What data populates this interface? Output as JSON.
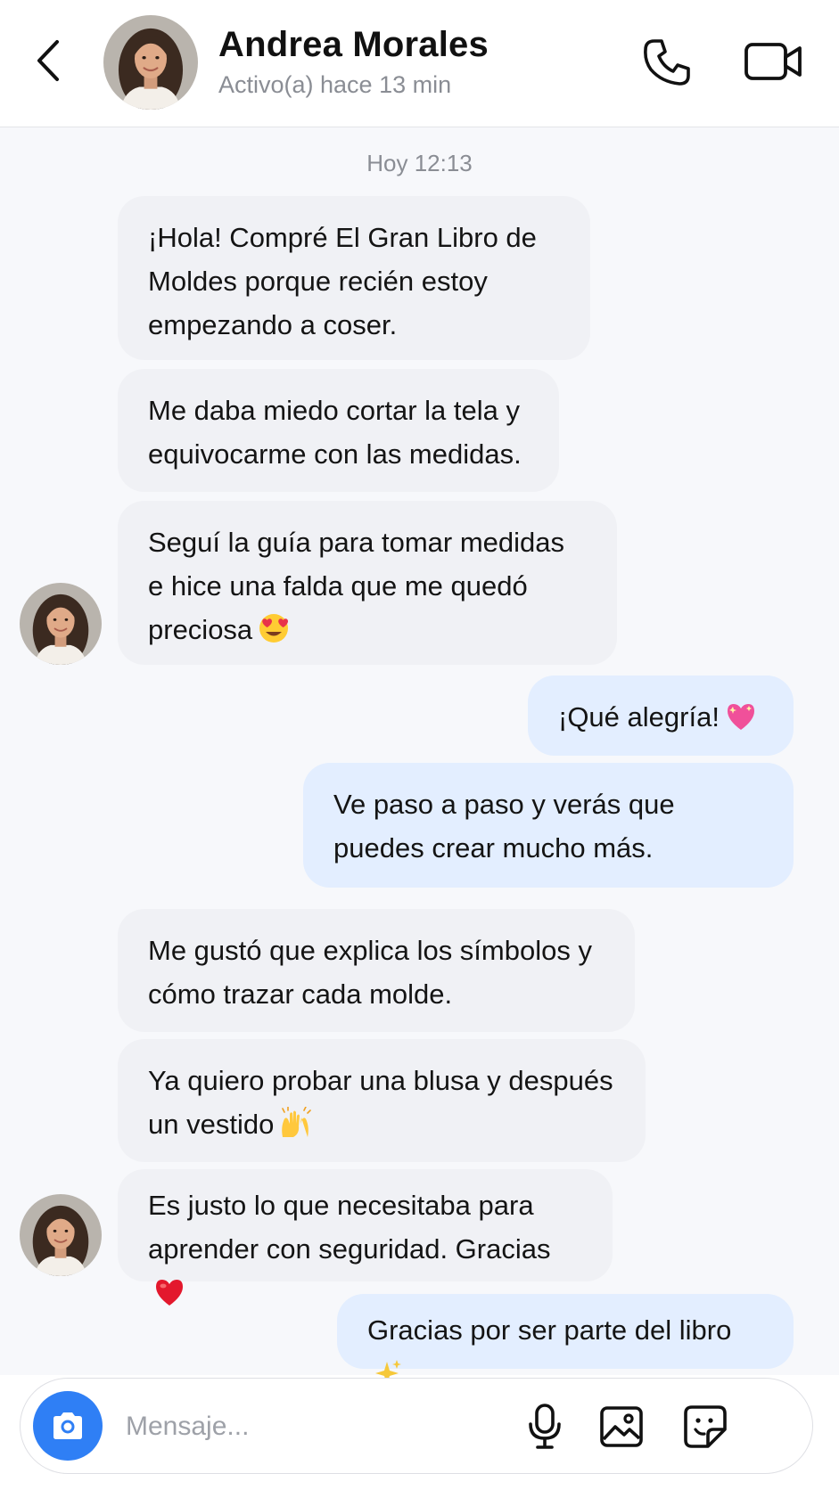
{
  "header": {
    "contact_name": "Andrea Morales",
    "status": "Activo(a) hace 13 min",
    "icons": [
      "back-chevron-icon",
      "phone-icon",
      "video-camera-icon"
    ]
  },
  "chat": {
    "timestamp": "Hoy 12:13",
    "messages": [
      {
        "direction": "in",
        "text": "¡Hola! Compré El Gran Libro de Moldes porque recién estoy empezando a coser.",
        "emoji": ""
      },
      {
        "direction": "in",
        "text": "Me daba miedo cortar la tela y equivocarme con las medidas.",
        "emoji": ""
      },
      {
        "direction": "in",
        "text": "Seguí la guía para tomar medidas e hice una falda que me quedó preciosa",
        "emoji": "😍"
      },
      {
        "direction": "out",
        "text": "¡Qué alegría!",
        "emoji": "💖"
      },
      {
        "direction": "out",
        "text": "Ve paso a paso y verás que puedes crear mucho más.",
        "emoji": ""
      },
      {
        "direction": "in",
        "text": "Me gustó que explica los símbolos y cómo trazar cada molde.",
        "emoji": ""
      },
      {
        "direction": "in",
        "text": "Ya quiero probar una blusa y después un vestido",
        "emoji": "🙌"
      },
      {
        "direction": "in",
        "text": "Es justo lo que necesitaba para aprender con seguridad. Gracias",
        "emoji": "❤️"
      },
      {
        "direction": "out",
        "text": "Gracias por ser parte del libro",
        "emoji": "✨"
      }
    ]
  },
  "composer": {
    "placeholder": "Mensaje...",
    "value": "",
    "icons": [
      "camera-icon",
      "microphone-icon",
      "image-icon",
      "sticker-icon"
    ]
  },
  "colors": {
    "incoming_bubble": "#f0f1f5",
    "outgoing_bubble": "#e3eeff",
    "accent": "#2f7ff5",
    "chat_background": "#f7f8fb"
  }
}
